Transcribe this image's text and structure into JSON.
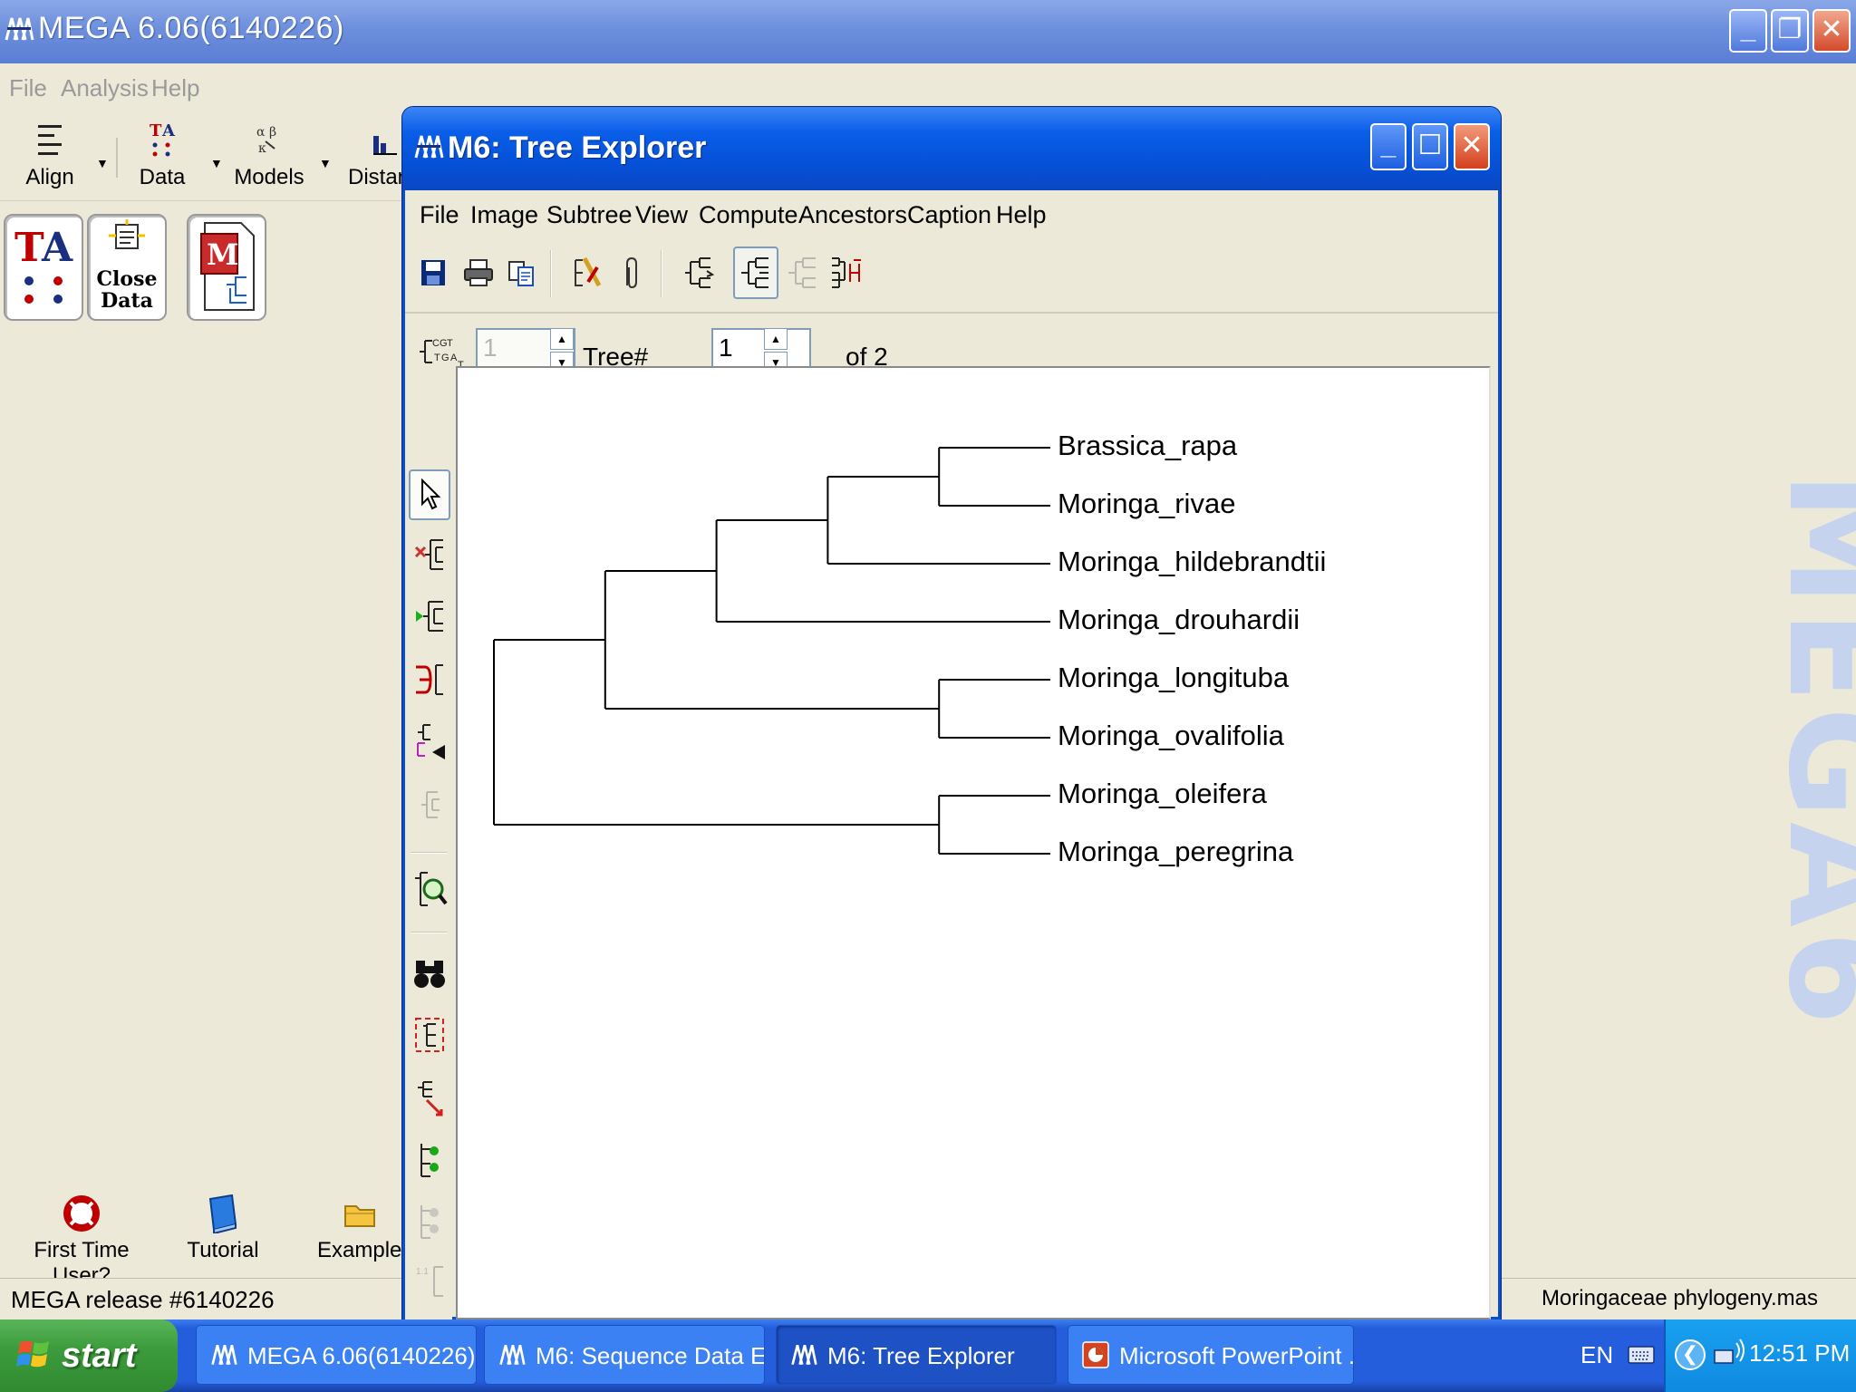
{
  "main_window": {
    "title": "MEGA 6.06(6140226)",
    "menu": [
      "File",
      "Analysis",
      "Help"
    ],
    "toolbar": [
      {
        "label": "Align",
        "icon": "align-icon"
      },
      {
        "label": "Data",
        "icon": "data-icon"
      },
      {
        "label": "Models",
        "icon": "models-icon"
      },
      {
        "label": "Distanc",
        "icon": "distance-icon"
      }
    ],
    "quick_buttons": [
      {
        "label": "TA",
        "icon": "ta-icon"
      },
      {
        "label": "Close Data",
        "icon": "close-data-icon"
      },
      {
        "label": "",
        "icon": "mega-document-icon"
      }
    ],
    "bottom_links": [
      {
        "label": "First Time User?",
        "icon": "lifebuoy-icon"
      },
      {
        "label": "Tutorial",
        "icon": "book-icon"
      },
      {
        "label": "Examples",
        "icon": "folder-icon"
      }
    ],
    "watermark": "MEGA6",
    "status_left": "MEGA release #6140226",
    "status_right": "Moringaceae phylogeny.mas"
  },
  "tree_explorer": {
    "title": "M6: Tree Explorer",
    "menu": [
      "File",
      "Image",
      "Subtree",
      "View",
      "Compute",
      "Ancestors",
      "Caption",
      "Help"
    ],
    "toolbar_icons": [
      "save-icon",
      "print-icon",
      "copy-icon",
      "options-icon",
      "clip-icon",
      "tree-layout-icon",
      "rectangular-tree-icon",
      "straight-tree-icon",
      "circle-tree-icon"
    ],
    "nav": {
      "first_value": "1",
      "tree_label": "Tree#",
      "tree_value": "1",
      "of_label": "of 2"
    },
    "taxa": [
      "Brassica_rapa",
      "Moringa_rivae",
      "Moringa_hildebrandtii",
      "Moringa_drouhardii",
      "Moringa_longituba",
      "Moringa_ovalifolia",
      "Moringa_oleifera",
      "Moringa_peregrina"
    ],
    "tree": {
      "format": "topology",
      "newick": "(((((Brassica_rapa,Moringa_rivae),Moringa_hildebrandtii),Moringa_drouhardii),(Moringa_longituba,Moringa_ovalifolia)),(Moringa_oleifera,Moringa_peregrina));"
    }
  },
  "taskbar": {
    "start_label": "start",
    "items": [
      {
        "label": "MEGA 6.06(6140226)",
        "active": false
      },
      {
        "label": "M6: Sequence Data E...",
        "active": false
      },
      {
        "label": "M6: Tree Explorer",
        "active": true
      },
      {
        "label": "Microsoft PowerPoint ...",
        "active": false
      }
    ],
    "language": "EN",
    "clock": "12:51 PM"
  }
}
